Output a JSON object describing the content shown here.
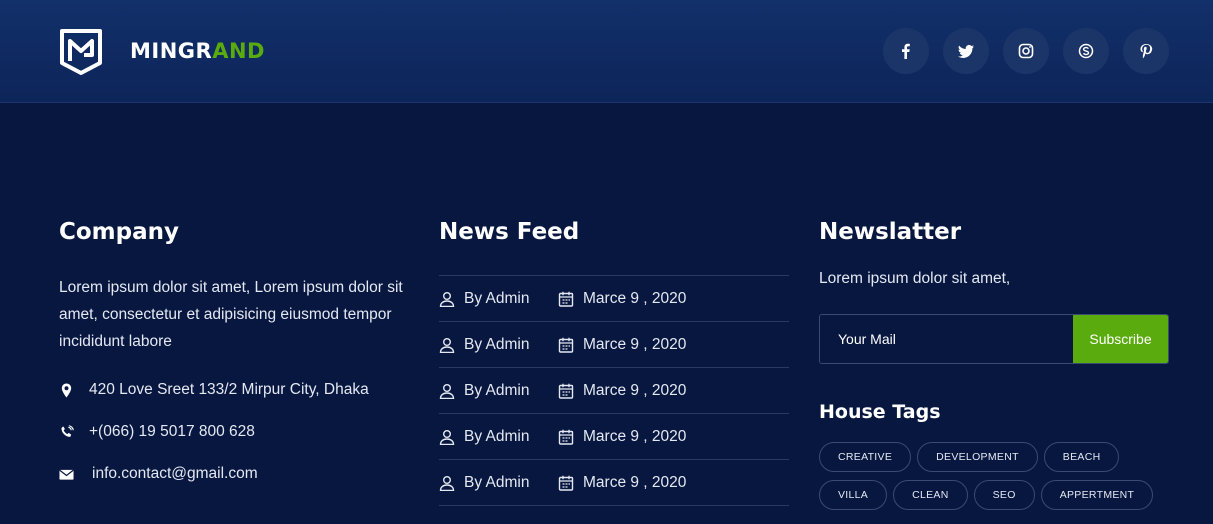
{
  "brand": {
    "name_part1": "MINGR",
    "name_part2": "AND",
    "accent": "#5aab0e"
  },
  "social": [
    {
      "icon": "facebook-icon",
      "glyph": "f"
    },
    {
      "icon": "twitter-icon",
      "glyph": ""
    },
    {
      "icon": "instagram-icon",
      "glyph": ""
    },
    {
      "icon": "skype-icon",
      "glyph": ""
    },
    {
      "icon": "pinterest-icon",
      "glyph": ""
    }
  ],
  "company": {
    "title": "Company",
    "about": "Lorem ipsum dolor sit amet, Lorem ipsum dolor sit amet, consectetur et adipisicing eiusmod tempor incididunt labore",
    "address": "420 Love Sreet 133/2 Mirpur City, Dhaka",
    "phone": "+(066) 19 5017 800 628",
    "email": "info.contact@gmail.com"
  },
  "news": {
    "title": "News Feed",
    "items": [
      {
        "author": "By Admin",
        "date": "Marce 9 , 2020"
      },
      {
        "author": "By Admin",
        "date": "Marce 9 , 2020"
      },
      {
        "author": "By Admin",
        "date": "Marce 9 , 2020"
      },
      {
        "author": "By Admin",
        "date": "Marce 9 , 2020"
      },
      {
        "author": "By Admin",
        "date": "Marce 9 , 2020"
      }
    ]
  },
  "newsletter": {
    "title": "Newslatter",
    "text": "Lorem ipsum dolor sit amet,",
    "placeholder": "Your Mail",
    "button": "Subscribe"
  },
  "tags": {
    "title": "House Tags",
    "items": [
      "CREATIVE",
      "DEVELOPMENT",
      "BEACH",
      "VILLA",
      "CLEAN",
      "SEO",
      "APPERTMENT"
    ]
  }
}
